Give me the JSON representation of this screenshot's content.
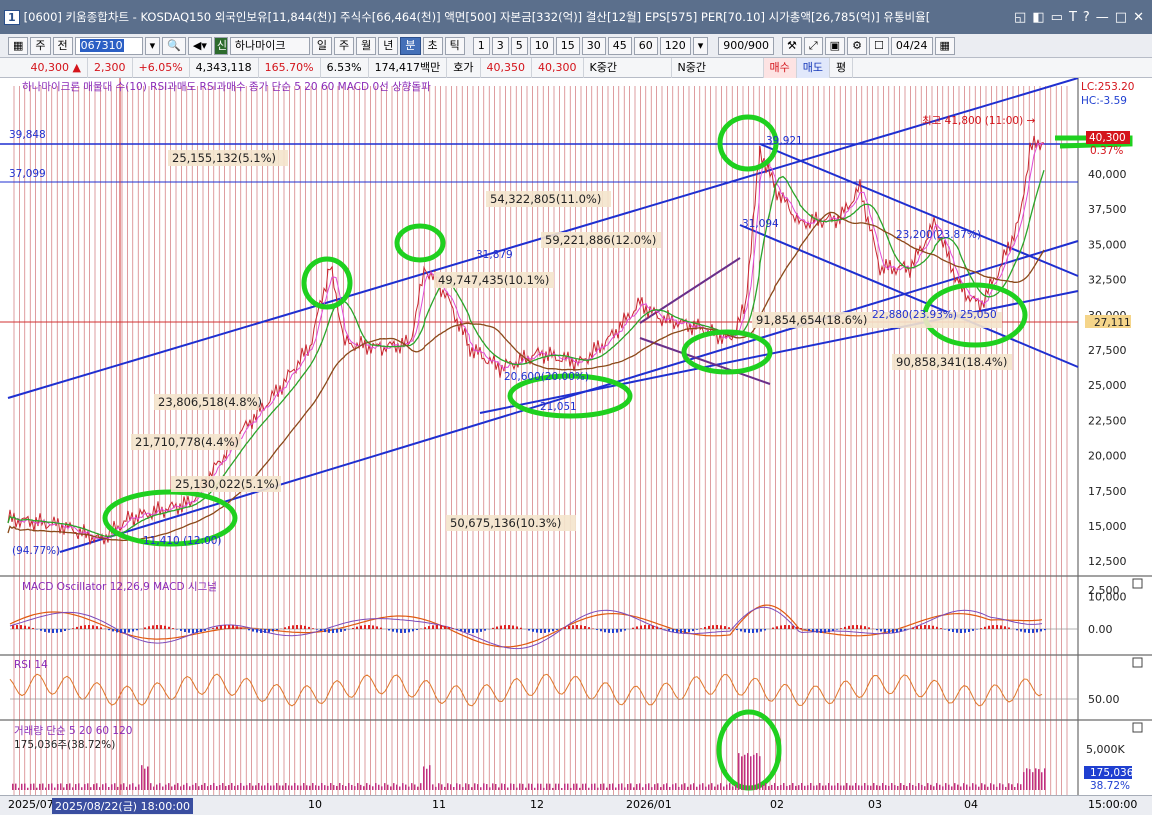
{
  "window": {
    "number": "1",
    "title": "[0600] 키움종합차트 - KOSDAQ150 외국인보유[11,844(천)] 주식수[66,464(천)] 액면[500] 자본금[332(억)] 결산[12월] EPS[575] PER[70.10] 시가총액[26,785(억)] 유통비율[",
    "controls": [
      "◱",
      "◧",
      "▭",
      "T",
      "?",
      "—",
      "□",
      "✕"
    ]
  },
  "toolbar": {
    "period_select": "주",
    "prev_button": "전",
    "stock_code": "067310",
    "company_badge": "신",
    "company_name": "하나마이크",
    "day_tab": "일",
    "week_tab": "주",
    "month_tab": "월",
    "year_tab": "년",
    "minute_tab": "분",
    "second_tab": "초",
    "tick_tab": "틱",
    "intervals": [
      "1",
      "3",
      "5",
      "10",
      "15",
      "30",
      "45",
      "60"
    ],
    "interval_select": "120",
    "count_value": "900/900",
    "date_value": "04/24"
  },
  "quote": {
    "price": "40,300 ▲",
    "change": "2,300",
    "change_pct": "+6.05%",
    "volume": "4,343,118",
    "volume_ratio": "165.70%",
    "turnover": "6.53%",
    "amount": "174,417백만",
    "ask_label": "호가",
    "ask": "40,350",
    "bid": "40,300",
    "k_label": "K중간",
    "n_label": "N중간",
    "buy_button": "매수",
    "sell_button": "매도",
    "avg_button": "평"
  },
  "chart": {
    "legend_top": "하나마이크론 매물대 수(10)   RSI과매도   RSI과매수   종가 단순 5  20  60   MACD 0선 상향돌파",
    "lc_label": "LC:253.20",
    "hc_label": "HC:-3.59",
    "top_left_value": "39,848",
    "left_value_2": "37,099",
    "high_label": "최고 41,800 (11:00) →",
    "current_price_tag": "40,300",
    "current_pct_tag": "0.37%",
    "mid_price_tag": "27,111",
    "price_ticks": [
      "40,000",
      "37,500",
      "35,000",
      "32,500",
      "30,000",
      "27,500",
      "25,000",
      "22,500",
      "20,000",
      "17,500",
      "15,000",
      "12,500",
      "10,000"
    ],
    "volume_profile": [
      "25,155,132(5.1%)",
      "54,322,805(11.0%)",
      "59,221,886(12.0%)",
      "49,747,435(10.1%)",
      "91,854,654(18.6%)",
      "90,858,341(18.4%)",
      "23,806,518(4.8%)",
      "21,710,778(4.4%)",
      "25,130,022(5.1%)",
      "50,675,136(10.3%)"
    ],
    "price_annotations": [
      "31,879",
      "39,921",
      "31,094",
      "22,880(23.93%)",
      "23,200(23.87%)",
      "20,600(20.00%)",
      "21,051",
      "25,050",
      "11,410 (12:00)",
      "(94.77%)"
    ],
    "macd_legend": "MACD Oscillator 12,26,9   MACD   시그널",
    "macd_ticks": [
      "2,500",
      "0.00"
    ],
    "rsi_legend": "RSI 14",
    "rsi_ticks": [
      "50.00"
    ],
    "volume_legend": "거래량 단순 5  20  60  120",
    "volume_info": "175,036주(38.72%)",
    "volume_ticks": [
      "5,000K"
    ],
    "volume_tag": "175,036",
    "volume_pct_tag": "38.72%"
  },
  "datebar": {
    "first": "2025/07",
    "cursor": "2025/08/22(금) 18:00:00",
    "months": [
      "10",
      "11",
      "12",
      "2026/01",
      "02",
      "03",
      "04"
    ],
    "time_right": "15:00:00"
  }
}
